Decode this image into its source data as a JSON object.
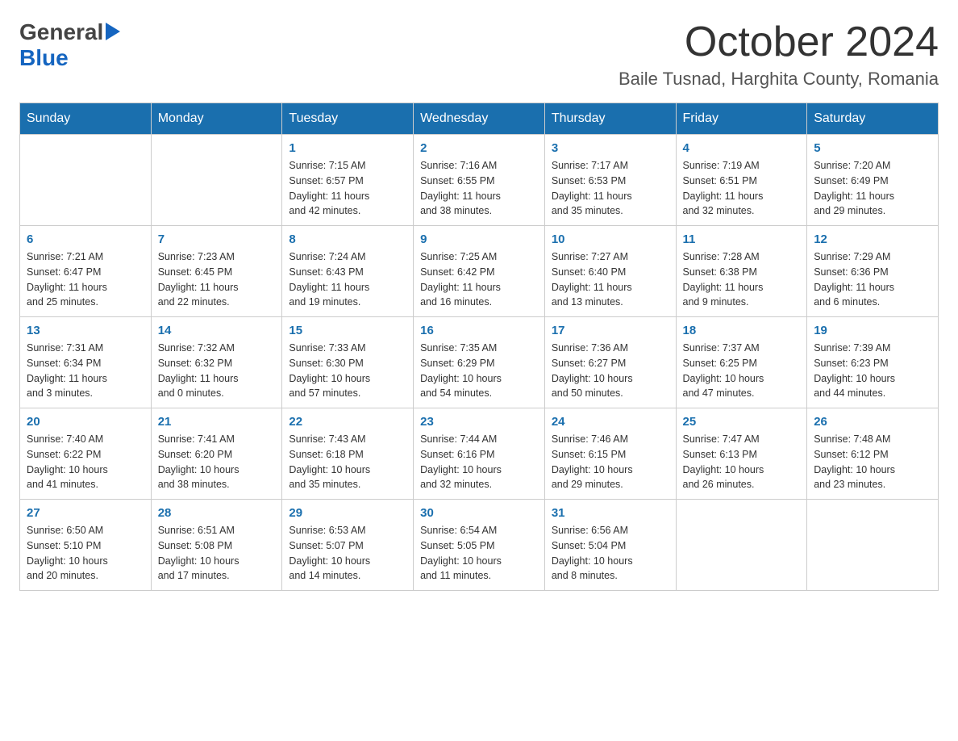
{
  "logo": {
    "general": "General",
    "blue": "Blue",
    "arrow_shape": "▶"
  },
  "title": {
    "month_year": "October 2024",
    "location": "Baile Tusnad, Harghita County, Romania"
  },
  "weekdays": [
    "Sunday",
    "Monday",
    "Tuesday",
    "Wednesday",
    "Thursday",
    "Friday",
    "Saturday"
  ],
  "weeks": [
    [
      {
        "day": "",
        "info": ""
      },
      {
        "day": "",
        "info": ""
      },
      {
        "day": "1",
        "info": "Sunrise: 7:15 AM\nSunset: 6:57 PM\nDaylight: 11 hours\nand 42 minutes."
      },
      {
        "day": "2",
        "info": "Sunrise: 7:16 AM\nSunset: 6:55 PM\nDaylight: 11 hours\nand 38 minutes."
      },
      {
        "day": "3",
        "info": "Sunrise: 7:17 AM\nSunset: 6:53 PM\nDaylight: 11 hours\nand 35 minutes."
      },
      {
        "day": "4",
        "info": "Sunrise: 7:19 AM\nSunset: 6:51 PM\nDaylight: 11 hours\nand 32 minutes."
      },
      {
        "day": "5",
        "info": "Sunrise: 7:20 AM\nSunset: 6:49 PM\nDaylight: 11 hours\nand 29 minutes."
      }
    ],
    [
      {
        "day": "6",
        "info": "Sunrise: 7:21 AM\nSunset: 6:47 PM\nDaylight: 11 hours\nand 25 minutes."
      },
      {
        "day": "7",
        "info": "Sunrise: 7:23 AM\nSunset: 6:45 PM\nDaylight: 11 hours\nand 22 minutes."
      },
      {
        "day": "8",
        "info": "Sunrise: 7:24 AM\nSunset: 6:43 PM\nDaylight: 11 hours\nand 19 minutes."
      },
      {
        "day": "9",
        "info": "Sunrise: 7:25 AM\nSunset: 6:42 PM\nDaylight: 11 hours\nand 16 minutes."
      },
      {
        "day": "10",
        "info": "Sunrise: 7:27 AM\nSunset: 6:40 PM\nDaylight: 11 hours\nand 13 minutes."
      },
      {
        "day": "11",
        "info": "Sunrise: 7:28 AM\nSunset: 6:38 PM\nDaylight: 11 hours\nand 9 minutes."
      },
      {
        "day": "12",
        "info": "Sunrise: 7:29 AM\nSunset: 6:36 PM\nDaylight: 11 hours\nand 6 minutes."
      }
    ],
    [
      {
        "day": "13",
        "info": "Sunrise: 7:31 AM\nSunset: 6:34 PM\nDaylight: 11 hours\nand 3 minutes."
      },
      {
        "day": "14",
        "info": "Sunrise: 7:32 AM\nSunset: 6:32 PM\nDaylight: 11 hours\nand 0 minutes."
      },
      {
        "day": "15",
        "info": "Sunrise: 7:33 AM\nSunset: 6:30 PM\nDaylight: 10 hours\nand 57 minutes."
      },
      {
        "day": "16",
        "info": "Sunrise: 7:35 AM\nSunset: 6:29 PM\nDaylight: 10 hours\nand 54 minutes."
      },
      {
        "day": "17",
        "info": "Sunrise: 7:36 AM\nSunset: 6:27 PM\nDaylight: 10 hours\nand 50 minutes."
      },
      {
        "day": "18",
        "info": "Sunrise: 7:37 AM\nSunset: 6:25 PM\nDaylight: 10 hours\nand 47 minutes."
      },
      {
        "day": "19",
        "info": "Sunrise: 7:39 AM\nSunset: 6:23 PM\nDaylight: 10 hours\nand 44 minutes."
      }
    ],
    [
      {
        "day": "20",
        "info": "Sunrise: 7:40 AM\nSunset: 6:22 PM\nDaylight: 10 hours\nand 41 minutes."
      },
      {
        "day": "21",
        "info": "Sunrise: 7:41 AM\nSunset: 6:20 PM\nDaylight: 10 hours\nand 38 minutes."
      },
      {
        "day": "22",
        "info": "Sunrise: 7:43 AM\nSunset: 6:18 PM\nDaylight: 10 hours\nand 35 minutes."
      },
      {
        "day": "23",
        "info": "Sunrise: 7:44 AM\nSunset: 6:16 PM\nDaylight: 10 hours\nand 32 minutes."
      },
      {
        "day": "24",
        "info": "Sunrise: 7:46 AM\nSunset: 6:15 PM\nDaylight: 10 hours\nand 29 minutes."
      },
      {
        "day": "25",
        "info": "Sunrise: 7:47 AM\nSunset: 6:13 PM\nDaylight: 10 hours\nand 26 minutes."
      },
      {
        "day": "26",
        "info": "Sunrise: 7:48 AM\nSunset: 6:12 PM\nDaylight: 10 hours\nand 23 minutes."
      }
    ],
    [
      {
        "day": "27",
        "info": "Sunrise: 6:50 AM\nSunset: 5:10 PM\nDaylight: 10 hours\nand 20 minutes."
      },
      {
        "day": "28",
        "info": "Sunrise: 6:51 AM\nSunset: 5:08 PM\nDaylight: 10 hours\nand 17 minutes."
      },
      {
        "day": "29",
        "info": "Sunrise: 6:53 AM\nSunset: 5:07 PM\nDaylight: 10 hours\nand 14 minutes."
      },
      {
        "day": "30",
        "info": "Sunrise: 6:54 AM\nSunset: 5:05 PM\nDaylight: 10 hours\nand 11 minutes."
      },
      {
        "day": "31",
        "info": "Sunrise: 6:56 AM\nSunset: 5:04 PM\nDaylight: 10 hours\nand 8 minutes."
      },
      {
        "day": "",
        "info": ""
      },
      {
        "day": "",
        "info": ""
      }
    ]
  ]
}
